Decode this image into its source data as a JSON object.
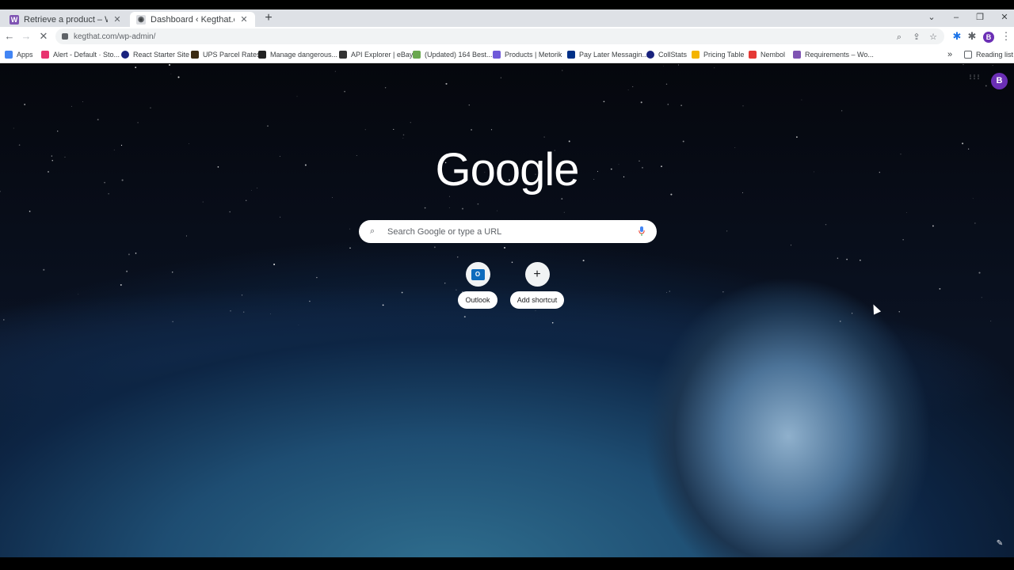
{
  "tabs": [
    {
      "title": "Retrieve a product – WooComme",
      "favicon": "W",
      "favicon_color": "#7f54b3",
      "active": false
    },
    {
      "title": "Dashboard ‹ Kegthat.com — Wo",
      "favicon": "◉",
      "favicon_color": "#3c4043",
      "active": true
    }
  ],
  "tab_close_glyph": "✕",
  "new_tab_glyph": "+",
  "window_controls": {
    "dropdown": "⌄",
    "minimize": "–",
    "restore": "❐",
    "close": "✕"
  },
  "toolbar": {
    "back_glyph": "←",
    "forward_glyph": "→",
    "reload_glyph": "✕",
    "url": "kegthat.com/wp-admin/",
    "zoom_glyph": "⌕",
    "share_glyph": "⇪",
    "star_glyph": "☆",
    "extensions_glyph": "✱",
    "menu_glyph": "⋮",
    "profile_initial": "B"
  },
  "bookmarks": {
    "items": [
      {
        "label": "Apps",
        "color": "#4285f4"
      },
      {
        "label": "Alert - Default · Sto...",
        "color": "#e8336f"
      },
      {
        "label": "React Starter Site",
        "color": "#1a237e"
      },
      {
        "label": "UPS Parcel Rates",
        "color": "#3a2a12"
      },
      {
        "label": "Manage dangerous...",
        "color": "#222222"
      },
      {
        "label": "API Explorer | eBay",
        "color": "#333333"
      },
      {
        "label": "(Updated) 164 Best...",
        "color": "#6aa84f"
      },
      {
        "label": "Products | Metorik",
        "color": "#6f59d9"
      },
      {
        "label": "Pay Later Messagin...",
        "color": "#003087"
      },
      {
        "label": "CollStats",
        "color": "#1a237e"
      },
      {
        "label": "Pricing Table",
        "color": "#f4b400"
      },
      {
        "label": "Nembol",
        "color": "#e53935"
      },
      {
        "label": "Requirements – Wo...",
        "color": "#7f54b3"
      }
    ],
    "overflow_glyph": "»",
    "reading_list": "Reading list"
  },
  "ntp": {
    "logo": "Google",
    "search_placeholder": "Search Google or type a URL",
    "search_glyph": "⌕",
    "mic_glyph": "🎤",
    "apps_glyph": "⋮⋮⋮",
    "profile_initial": "B",
    "customize_glyph": "✎",
    "shortcuts": [
      {
        "label": "Outlook",
        "icon": "O"
      },
      {
        "label": "Add shortcut",
        "icon": "+"
      }
    ]
  },
  "icons": [
    "back-icon",
    "forward-icon",
    "reload-icon",
    "lock-icon",
    "zoom-icon",
    "share-icon",
    "star-icon",
    "extensions-icon",
    "menu-icon",
    "apps-icon",
    "search-icon",
    "mic-icon",
    "outlook-icon",
    "add-icon",
    "edit-icon"
  ]
}
